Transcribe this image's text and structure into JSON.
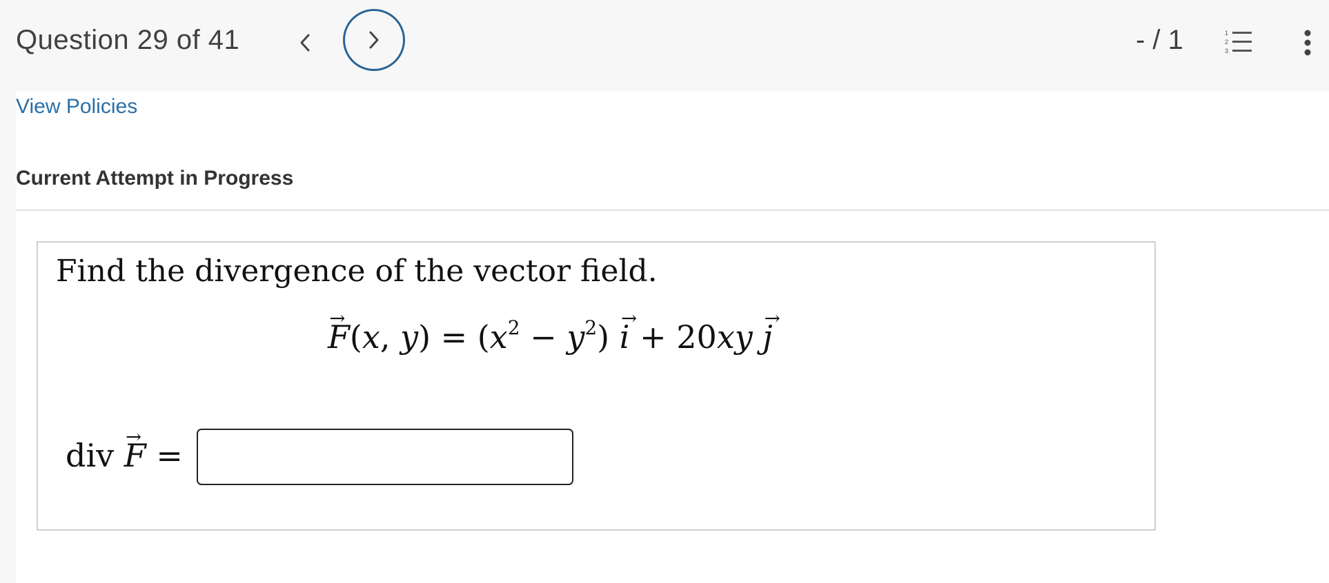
{
  "header": {
    "question_label": "Question 29 of 41",
    "score": "- / 1",
    "icons": {
      "prev": "chevron-left-icon",
      "next": "chevron-right-icon",
      "list": "numbered-list-icon",
      "more": "more-vertical-icon"
    },
    "accent_color": "#2a6496"
  },
  "links": {
    "policies": "View Policies"
  },
  "attempt": {
    "heading": "Current Attempt in Progress"
  },
  "question": {
    "prompt": "Find the divergence of the vector field.",
    "formula": "F(x, y) = (x² − y²) i + 20xy j",
    "coefficient": "20",
    "answer_label": "div F =",
    "answer_value": ""
  }
}
